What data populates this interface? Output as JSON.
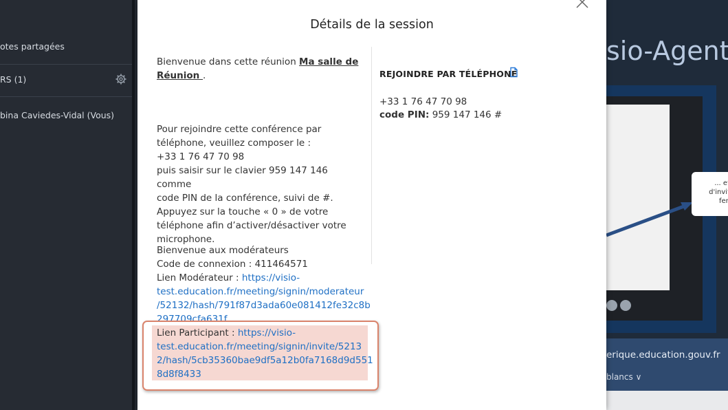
{
  "sidebar": {
    "shared_notes": "otes partagées",
    "users_header": "RS (1)",
    "user_name": "bina Caviedes-Vidal (Vous)"
  },
  "background": {
    "title": "sio-Agents",
    "bubble_lines": [
      "... et",
      "d'invit",
      "fen"
    ],
    "url": "erique.education.gouv.fr",
    "blancs": "blancs"
  },
  "modal": {
    "title": "Détails de la session",
    "welcome_prefix": "Bienvenue dans cette réunion ",
    "room_name_1": "Ma salle de",
    "room_name_2": "Réunion ",
    "room_name_suffix": ".",
    "phone_lines": [
      "Pour rejoindre cette conférence par",
      "téléphone, veuillez composer le :",
      "+33 1 76 47 70 98",
      "puis saisir sur le clavier 959 147 146 comme",
      "code PIN de la conférence, suivi de #.",
      "Appuyez sur la touche « 0 » de votre",
      "téléphone afin d’activer/désactiver votre",
      "microphone."
    ],
    "mod_welcome": "Bienvenue aux modérateurs",
    "mod_code": "Code de connexion : 411464571",
    "mod_link_label": "Lien Modérateur  : ",
    "mod_link_lines": [
      "https://visio-",
      "test.education.fr/meeting/signin/moderateur",
      "/52132/hash/791f87d3ada60e081412fe32c8b",
      "297709cfa631f"
    ],
    "part_link_label": "Lien Participant  : ",
    "part_link_lines": [
      "https://visio-",
      "test.education.fr/meeting/signin/invite/5213",
      "2/hash/5cb35360bae9df5a12b0fa7168d9d551",
      "8d8f8433"
    ],
    "phone_join_title": "REJOINDRE PAR TÉLÉPHONE",
    "phone_number": "+33 1 76 47 70 98",
    "pin_label": "code PIN:",
    "pin_value": " 959 147 146 #"
  }
}
